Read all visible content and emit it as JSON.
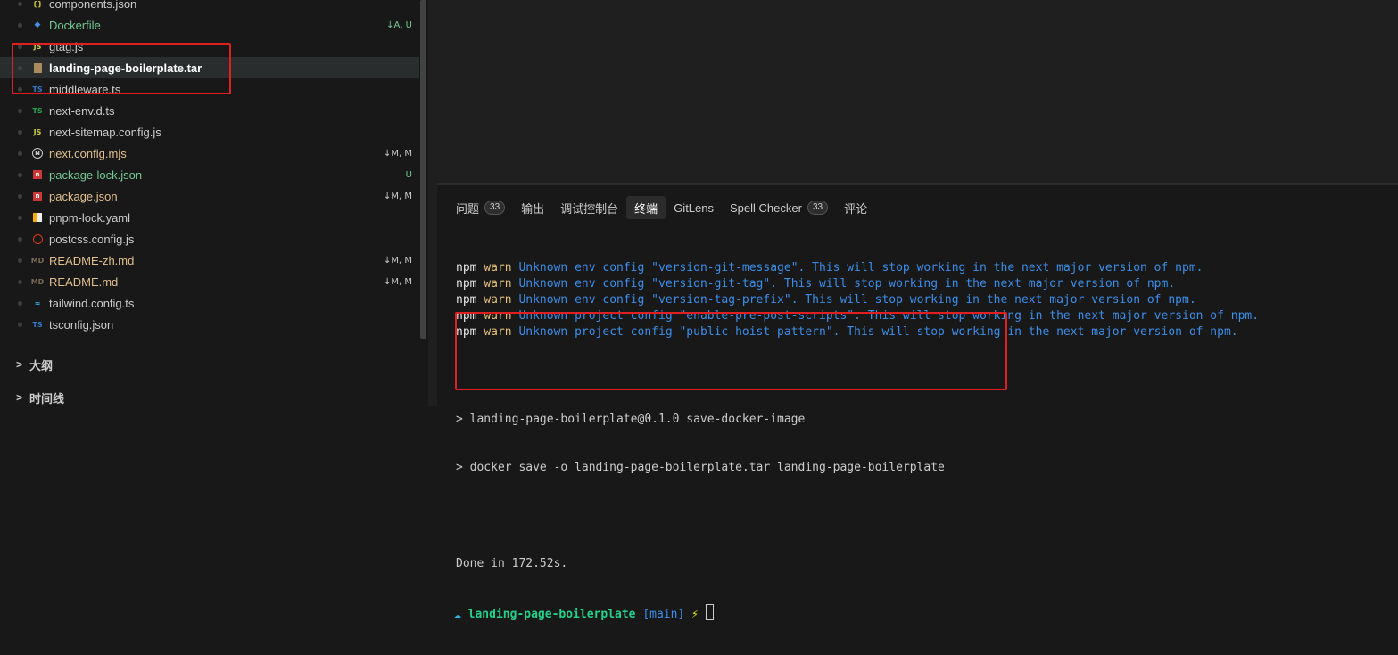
{
  "explorer": {
    "files": [
      {
        "name": "components.json",
        "icon": "{}",
        "icon_color": "#cbcb41",
        "text_color": "#cccccc",
        "badge": ""
      },
      {
        "name": "Dockerfile",
        "icon": "docker-icon",
        "icon_color": "#458ee6",
        "text_color": "#73c991",
        "badge": "↓A, U",
        "badge_color": "#73c991"
      },
      {
        "name": "gtag.js",
        "icon": "JS",
        "icon_color": "#cbcb41",
        "text_color": "#cccccc",
        "badge": ""
      },
      {
        "name": "landing-page-boilerplate.tar",
        "icon": "archive-icon",
        "icon_color": "#a88a5c",
        "text_color": "#ffffff",
        "badge": "",
        "selected": true
      },
      {
        "name": "middleware.ts",
        "icon": "TS",
        "icon_color": "#3178c6",
        "text_color": "#cccccc",
        "badge": ""
      },
      {
        "name": "next-env.d.ts",
        "icon": "TS",
        "icon_color": "#2ea44f",
        "text_color": "#cccccc",
        "badge": ""
      },
      {
        "name": "next-sitemap.config.js",
        "icon": "JS",
        "icon_color": "#cbcb41",
        "text_color": "#cccccc",
        "badge": ""
      },
      {
        "name": "next.config.mjs",
        "icon": "N",
        "icon_color": "#cccccc",
        "text_color": "#e2c08d",
        "badge": "↓M, M",
        "badge_color": "#c9c9c9"
      },
      {
        "name": "package-lock.json",
        "icon": "n",
        "icon_color": "#cb3837",
        "text_color": "#73c991",
        "badge": "U",
        "badge_color": "#73c991"
      },
      {
        "name": "package.json",
        "icon": "n",
        "icon_color": "#cb3837",
        "text_color": "#e2c08d",
        "badge": "↓M, M",
        "badge_color": "#c9c9c9"
      },
      {
        "name": "pnpm-lock.yaml",
        "icon": "pnpm-icon",
        "icon_color": "#f9ad00",
        "text_color": "#cccccc",
        "badge": ""
      },
      {
        "name": "postcss.config.js",
        "icon": "postcss-icon",
        "icon_color": "#dd3a0a",
        "text_color": "#cccccc",
        "badge": ""
      },
      {
        "name": "README-zh.md",
        "icon": "MD",
        "icon_color": "#7a6a55",
        "text_color": "#e2c08d",
        "badge": "↓M, M",
        "badge_color": "#c9c9c9"
      },
      {
        "name": "README.md",
        "icon": "MD",
        "icon_color": "#7a6a55",
        "text_color": "#e2c08d",
        "badge": "↓M, M",
        "badge_color": "#c9c9c9"
      },
      {
        "name": "tailwind.config.ts",
        "icon": "≈",
        "icon_color": "#38bdf8",
        "text_color": "#cccccc",
        "badge": ""
      },
      {
        "name": "tsconfig.json",
        "icon": "TS",
        "icon_color": "#3178c6",
        "text_color": "#cccccc",
        "badge": ""
      }
    ],
    "sections": [
      {
        "label": "大纲"
      },
      {
        "label": "时间线"
      }
    ]
  },
  "panel": {
    "tabs": [
      {
        "label": "问题",
        "count": "33",
        "active": false
      },
      {
        "label": "输出",
        "count": "",
        "active": false
      },
      {
        "label": "调试控制台",
        "count": "",
        "active": false
      },
      {
        "label": "终端",
        "count": "",
        "active": true
      },
      {
        "label": "GitLens",
        "count": "",
        "active": false
      },
      {
        "label": "Spell Checker",
        "count": "33",
        "active": false
      },
      {
        "label": "评论",
        "count": "",
        "active": false
      }
    ],
    "terminal": {
      "warnings": [
        "Unknown env config \"version-git-message\". This will stop working in the next major version of npm.",
        "Unknown env config \"version-git-tag\". This will stop working in the next major version of npm.",
        "Unknown env config \"version-tag-prefix\". This will stop working in the next major version of npm.",
        "Unknown project config \"enable-pre-post-scripts\". This will stop working in the next major version of npm.",
        "Unknown project config \"public-hoist-pattern\". This will stop working in the next major version of npm."
      ],
      "warn_prefix_1": "npm",
      "warn_prefix_2": "warn",
      "output_lines": [
        "> landing-page-boilerplate@0.1.0 save-docker-image",
        "> docker save -o landing-page-boilerplate.tar landing-page-boilerplate",
        "",
        "Done in 172.52s."
      ],
      "prompt": {
        "dir": "landing-page-boilerplate",
        "branch": "[main]",
        "symbol": "⚡"
      }
    }
  },
  "colors": {
    "highlight": "#e02020",
    "background": "#181818"
  }
}
